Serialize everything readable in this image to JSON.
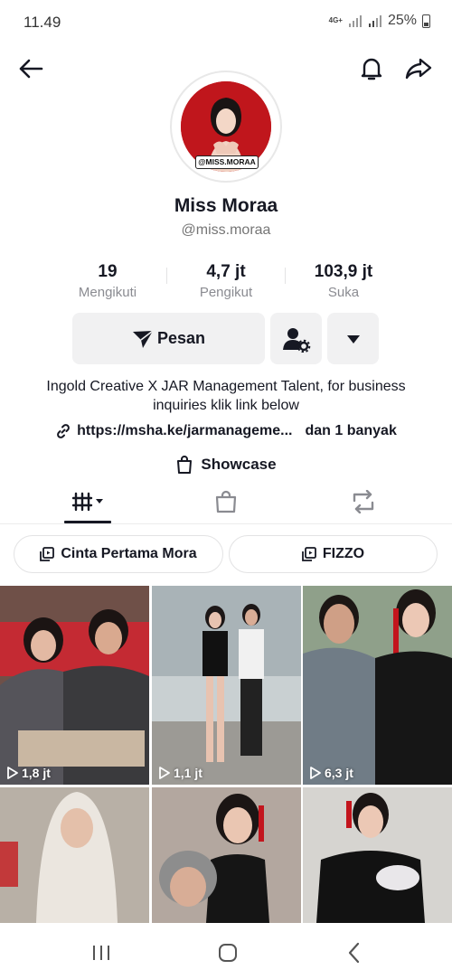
{
  "status_bar": {
    "time": "11.49",
    "network": "4G+",
    "battery": "25%"
  },
  "profile": {
    "avatar_tag": "@MISS.MORAA",
    "display_name": "Miss Moraa",
    "username": "@miss.moraa"
  },
  "stats": [
    {
      "value": "19",
      "label": "Mengikuti"
    },
    {
      "value": "4,7 jt",
      "label": "Pengikut"
    },
    {
      "value": "103,9 jt",
      "label": "Suka"
    }
  ],
  "actions": {
    "message_label": "Pesan"
  },
  "bio": {
    "text": "Ingold Creative X JAR Management Talent, for business inquiries klik link below",
    "link": "https://msha.ke/jarmanageme...",
    "link_extra": "dan 1 banyak",
    "showcase": "Showcase"
  },
  "playlists": [
    "Cinta Pertama Mora",
    "FIZZO"
  ],
  "videos": [
    {
      "views": "1,8 jt",
      "color": "#7a5a50"
    },
    {
      "views": "1,1 jt",
      "color": "#9aa3a8"
    },
    {
      "views": "6,3 jt",
      "color": "#8e9a86"
    },
    {
      "views": "",
      "color": "#b9b5ad"
    },
    {
      "views": "",
      "color": "#a89c94"
    },
    {
      "views": "",
      "color": "#c9c6c1"
    }
  ],
  "colors": {
    "accent_red": "#c0161c",
    "text": "#161823",
    "muted": "#8a8b91",
    "button_bg": "#f1f1f2"
  }
}
